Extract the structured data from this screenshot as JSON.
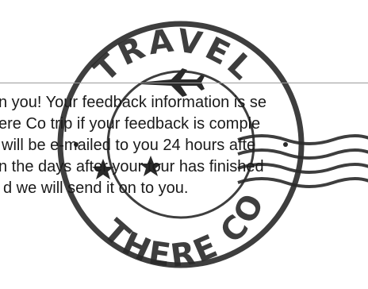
{
  "stamp": {
    "top_text": "TRAVEL",
    "bottom_text": "THERE CO",
    "ink_color": "#2a2a2a"
  },
  "message": {
    "lines": [
      "n you! Your feedback information is se",
      "ere Co trip if your feedback is comple",
      "will be e-mailed to you 24 hours afte",
      "n the days after your tour has finished",
      "d we will send it on to you."
    ]
  }
}
